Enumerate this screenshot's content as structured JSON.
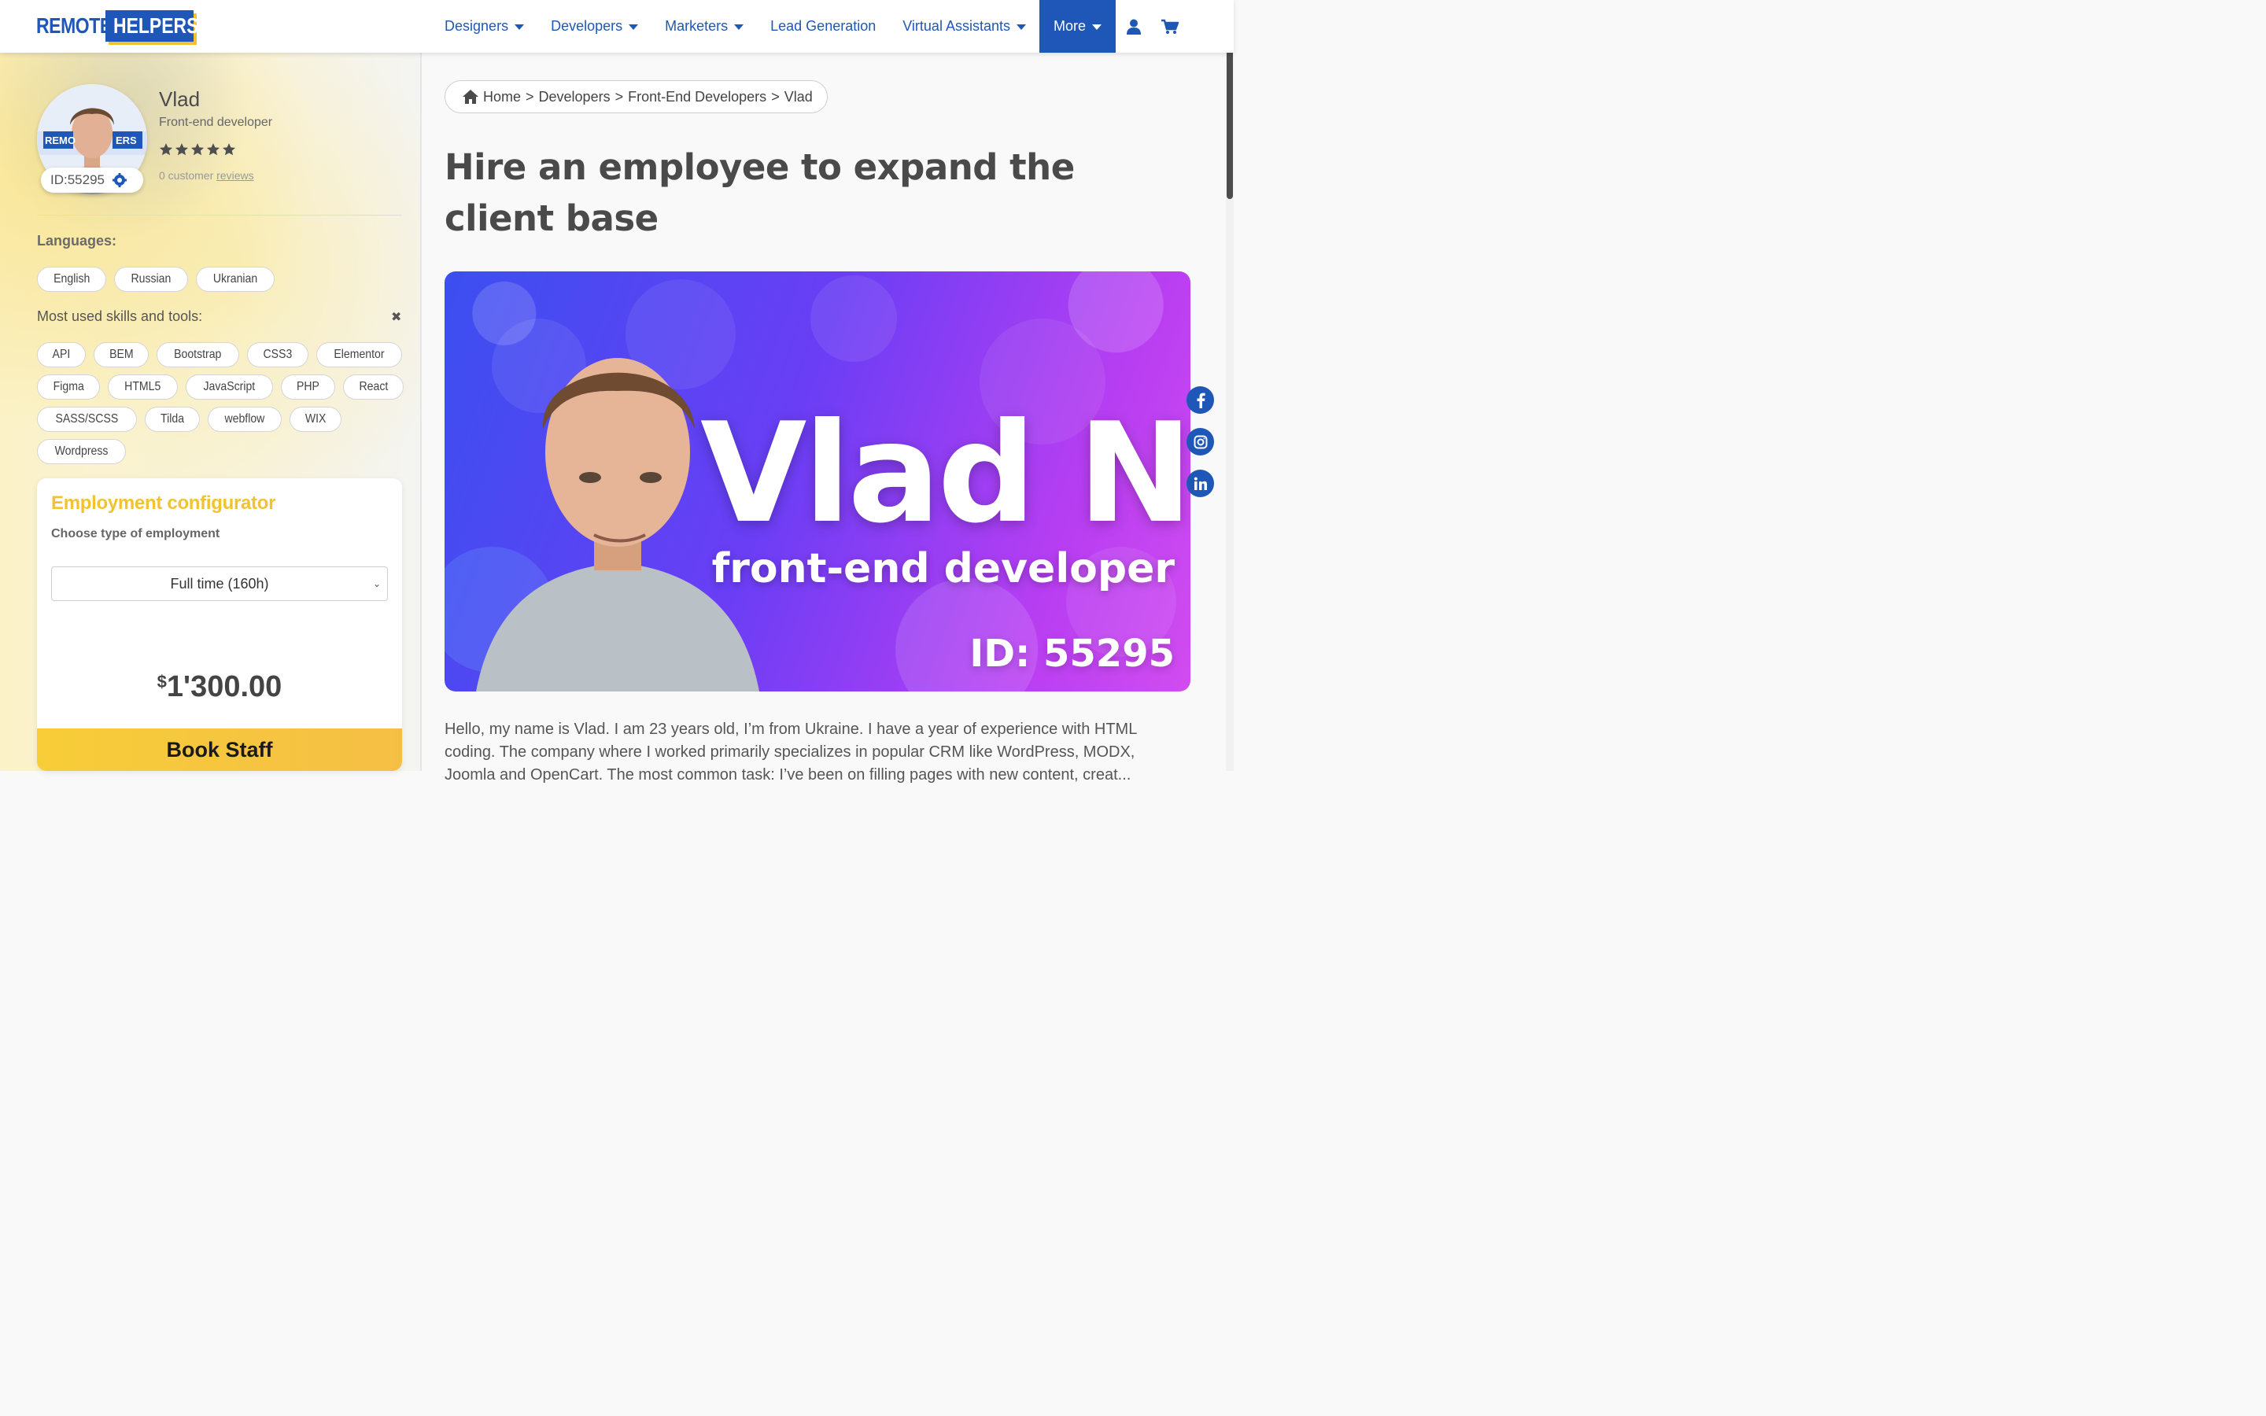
{
  "brand": {
    "logo_part1": "REMOTE",
    "logo_part2": "HELPERS"
  },
  "nav": {
    "items": [
      {
        "label": "Designers",
        "dropdown": true
      },
      {
        "label": "Developers",
        "dropdown": true
      },
      {
        "label": "Marketers",
        "dropdown": true
      },
      {
        "label": "Lead Generation",
        "dropdown": false
      },
      {
        "label": "Virtual Assistants",
        "dropdown": true
      }
    ],
    "more_label": "More",
    "icons": [
      "user-icon",
      "cart-icon"
    ]
  },
  "profile": {
    "name": "Vlad",
    "role": "Front-end developer",
    "rating_stars": 5,
    "reviews_count_text": "0 customer ",
    "reviews_link": "reviews",
    "id_text": "ID:55295",
    "avatar_logo_text": "REMO     ERS"
  },
  "languages": {
    "title": "Languages:",
    "items": [
      "English",
      "Russian",
      "Ukranian"
    ]
  },
  "skills": {
    "title": "Most used skills and tools:",
    "close_icon": "✖",
    "items": [
      "API",
      "BEM",
      "Bootstrap",
      "CSS3",
      "Elementor",
      "Figma",
      "HTML5",
      "JavaScript",
      "PHP",
      "React",
      "SASS/SCSS",
      "Tilda",
      "webflow",
      "WIX",
      "Wordpress"
    ]
  },
  "configurator": {
    "title": "Employment configurator",
    "subtitle": "Choose type of employment",
    "selected": "Full time (160h)",
    "price_currency": "$",
    "price_value": "1'300.00",
    "book_label": "Book Staff"
  },
  "breadcrumb": {
    "home": "Home",
    "sep": ">",
    "items": [
      "Developers",
      "Front-End Developers",
      "Vlad"
    ]
  },
  "main": {
    "title": "Hire an employee to expand the client base",
    "hero_name": "Vlad N",
    "hero_role": "front-end developer",
    "hero_id": "ID: 55295",
    "intro": "Hello, my name is Vlad. I am 23 years old, I’m from Ukraine. I have a year of experience with HTML coding. The company where I worked primarily specializes in popular CRM like WordPress, MODX, Joomla and OpenCart. The most common task: I’ve been on filling pages with new content, creat..."
  },
  "social": [
    "facebook-icon",
    "instagram-icon",
    "linkedin-icon"
  ],
  "colors": {
    "brand_blue": "#1f57b8",
    "accent_yellow": "#f2c230",
    "hero_gradient_start": "#3b4ff0",
    "hero_gradient_end": "#d14cf0"
  }
}
